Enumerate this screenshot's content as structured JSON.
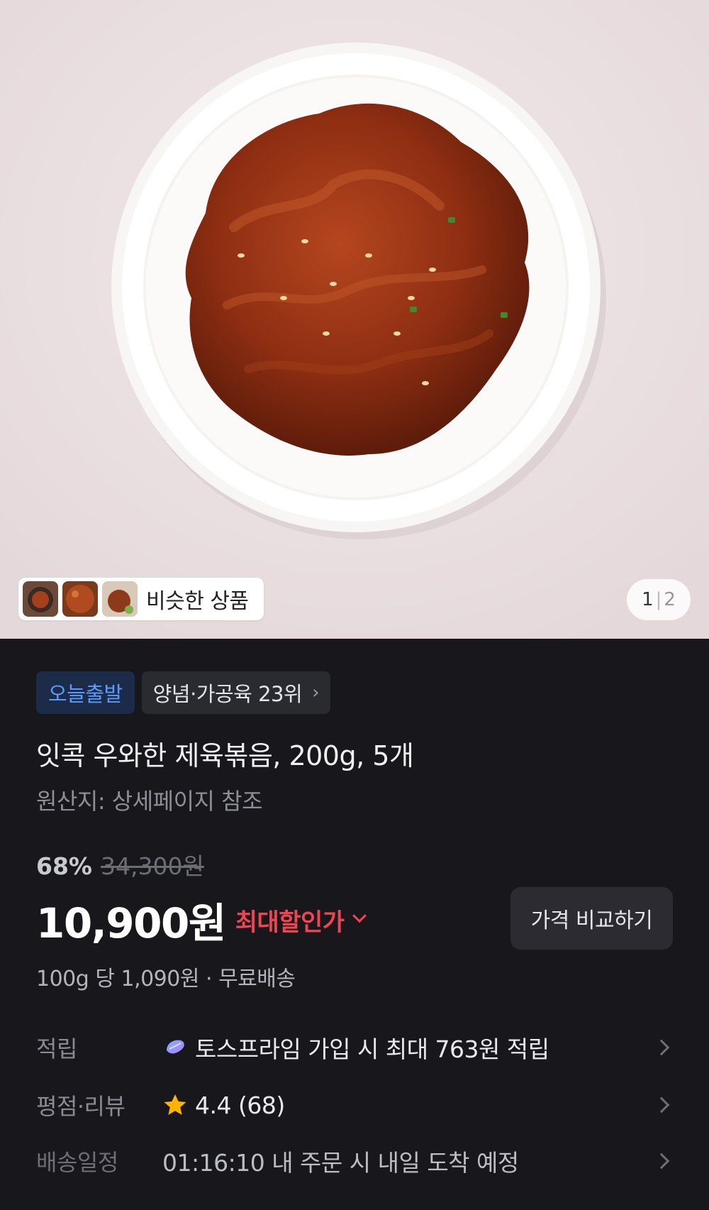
{
  "hero": {
    "similar_label": "비슷한 상품",
    "page_current": "1",
    "page_total": "2"
  },
  "badges": {
    "today": "오늘출발",
    "rank": "양념·가공육 23위"
  },
  "product": {
    "title": "잇콕 우와한 제육볶음, 200g, 5개",
    "origin": "원산지: 상세페이지 참조",
    "discount_rate": "68%",
    "original_price": "34,300원",
    "price": "10,900원",
    "max_discount_label": "최대할인가",
    "compare_button": "가격 비교하기",
    "unit_info": "100g 당 1,090원 · 무료배송"
  },
  "details": {
    "reward_key": "적립",
    "reward_value": "토스프라임 가입 시 최대 763원 적립",
    "rating_key": "평점·리뷰",
    "rating_value": "4.4 (68)",
    "shipping_key": "배송일정",
    "shipping_value": "01:16:10 내 주문 시 내일 도착 예정"
  },
  "colors": {
    "accent_blue": "#5b9bff",
    "discount_red": "#f04452",
    "star": "#ffb400",
    "background": "#17171c"
  }
}
